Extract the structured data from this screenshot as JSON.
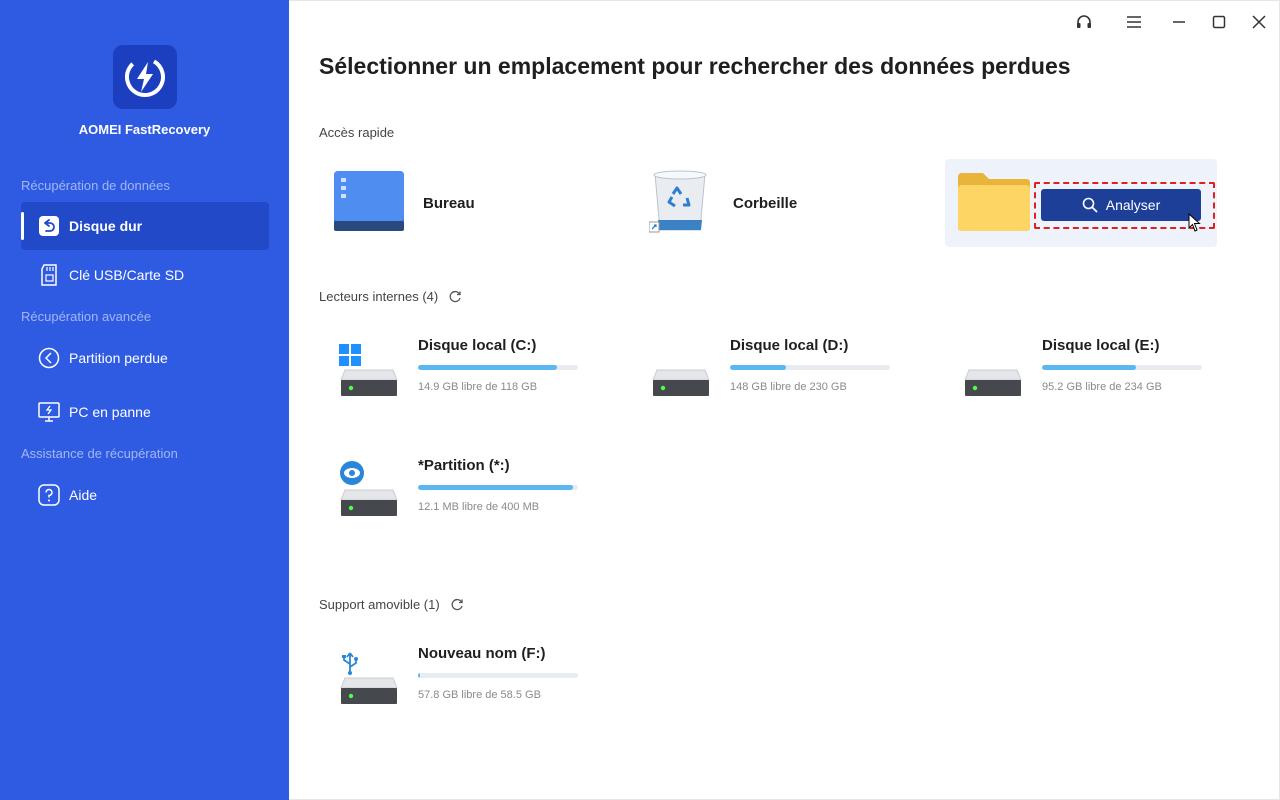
{
  "app": {
    "name": "AOMEI FastRecovery"
  },
  "sidebar": {
    "sections": [
      {
        "label": "Récupération de données"
      },
      {
        "label": "Récupération avancée"
      },
      {
        "label": "Assistance de récupération"
      }
    ],
    "items": [
      {
        "label": "Disque dur",
        "icon": "hard-drive-restore-icon",
        "active": true
      },
      {
        "label": "Clé USB/Carte SD",
        "icon": "sd-card-icon",
        "active": false
      },
      {
        "label": "Partition perdue",
        "icon": "lost-partition-icon",
        "active": false
      },
      {
        "label": "PC en panne",
        "icon": "crashed-pc-icon",
        "active": false
      },
      {
        "label": "Aide",
        "icon": "help-icon",
        "active": false
      }
    ]
  },
  "main": {
    "title": "Sélectionner un emplacement pour rechercher des données perdues",
    "quick_access": {
      "label": "Accès rapide",
      "items": [
        {
          "label": "Bureau",
          "icon": "desktop-icon"
        },
        {
          "label": "Corbeille",
          "icon": "recycle-bin-icon"
        },
        {
          "label": "",
          "icon": "folder-icon"
        }
      ],
      "scan_button": "Analyser"
    },
    "internal_drives": {
      "label": "Lecteurs internes (4)",
      "drives": [
        {
          "name": "Disque local (C:)",
          "free": "14.9 GB libre de 118 GB",
          "used_fraction": 0.87,
          "badge": "windows-logo-icon"
        },
        {
          "name": "Disque local (D:)",
          "free": "148 GB libre de 230 GB",
          "used_fraction": 0.35,
          "badge": ""
        },
        {
          "name": "Disque local (E:)",
          "free": "95.2 GB libre de 234 GB",
          "used_fraction": 0.59,
          "badge": ""
        },
        {
          "name": "*Partition (*:)",
          "free": "12.1 MB libre de 400 MB",
          "used_fraction": 0.97,
          "badge": "hidden-eye-icon"
        }
      ]
    },
    "removable": {
      "label": "Support amovible (1)",
      "drives": [
        {
          "name": "Nouveau nom (F:)",
          "free": "57.8 GB libre de 58.5 GB",
          "used_fraction": 0.012,
          "badge": "usb-icon"
        }
      ]
    }
  },
  "window_controls": [
    "support-headset-icon",
    "menu-icon",
    "minimize-icon",
    "maximize-icon",
    "close-icon"
  ],
  "colors": {
    "sidebar": "#2f5be3",
    "sidebar_active": "#2149c8",
    "button": "#1d3f97",
    "progress": "#5ab7f0",
    "highlight_outline": "#e02020"
  }
}
